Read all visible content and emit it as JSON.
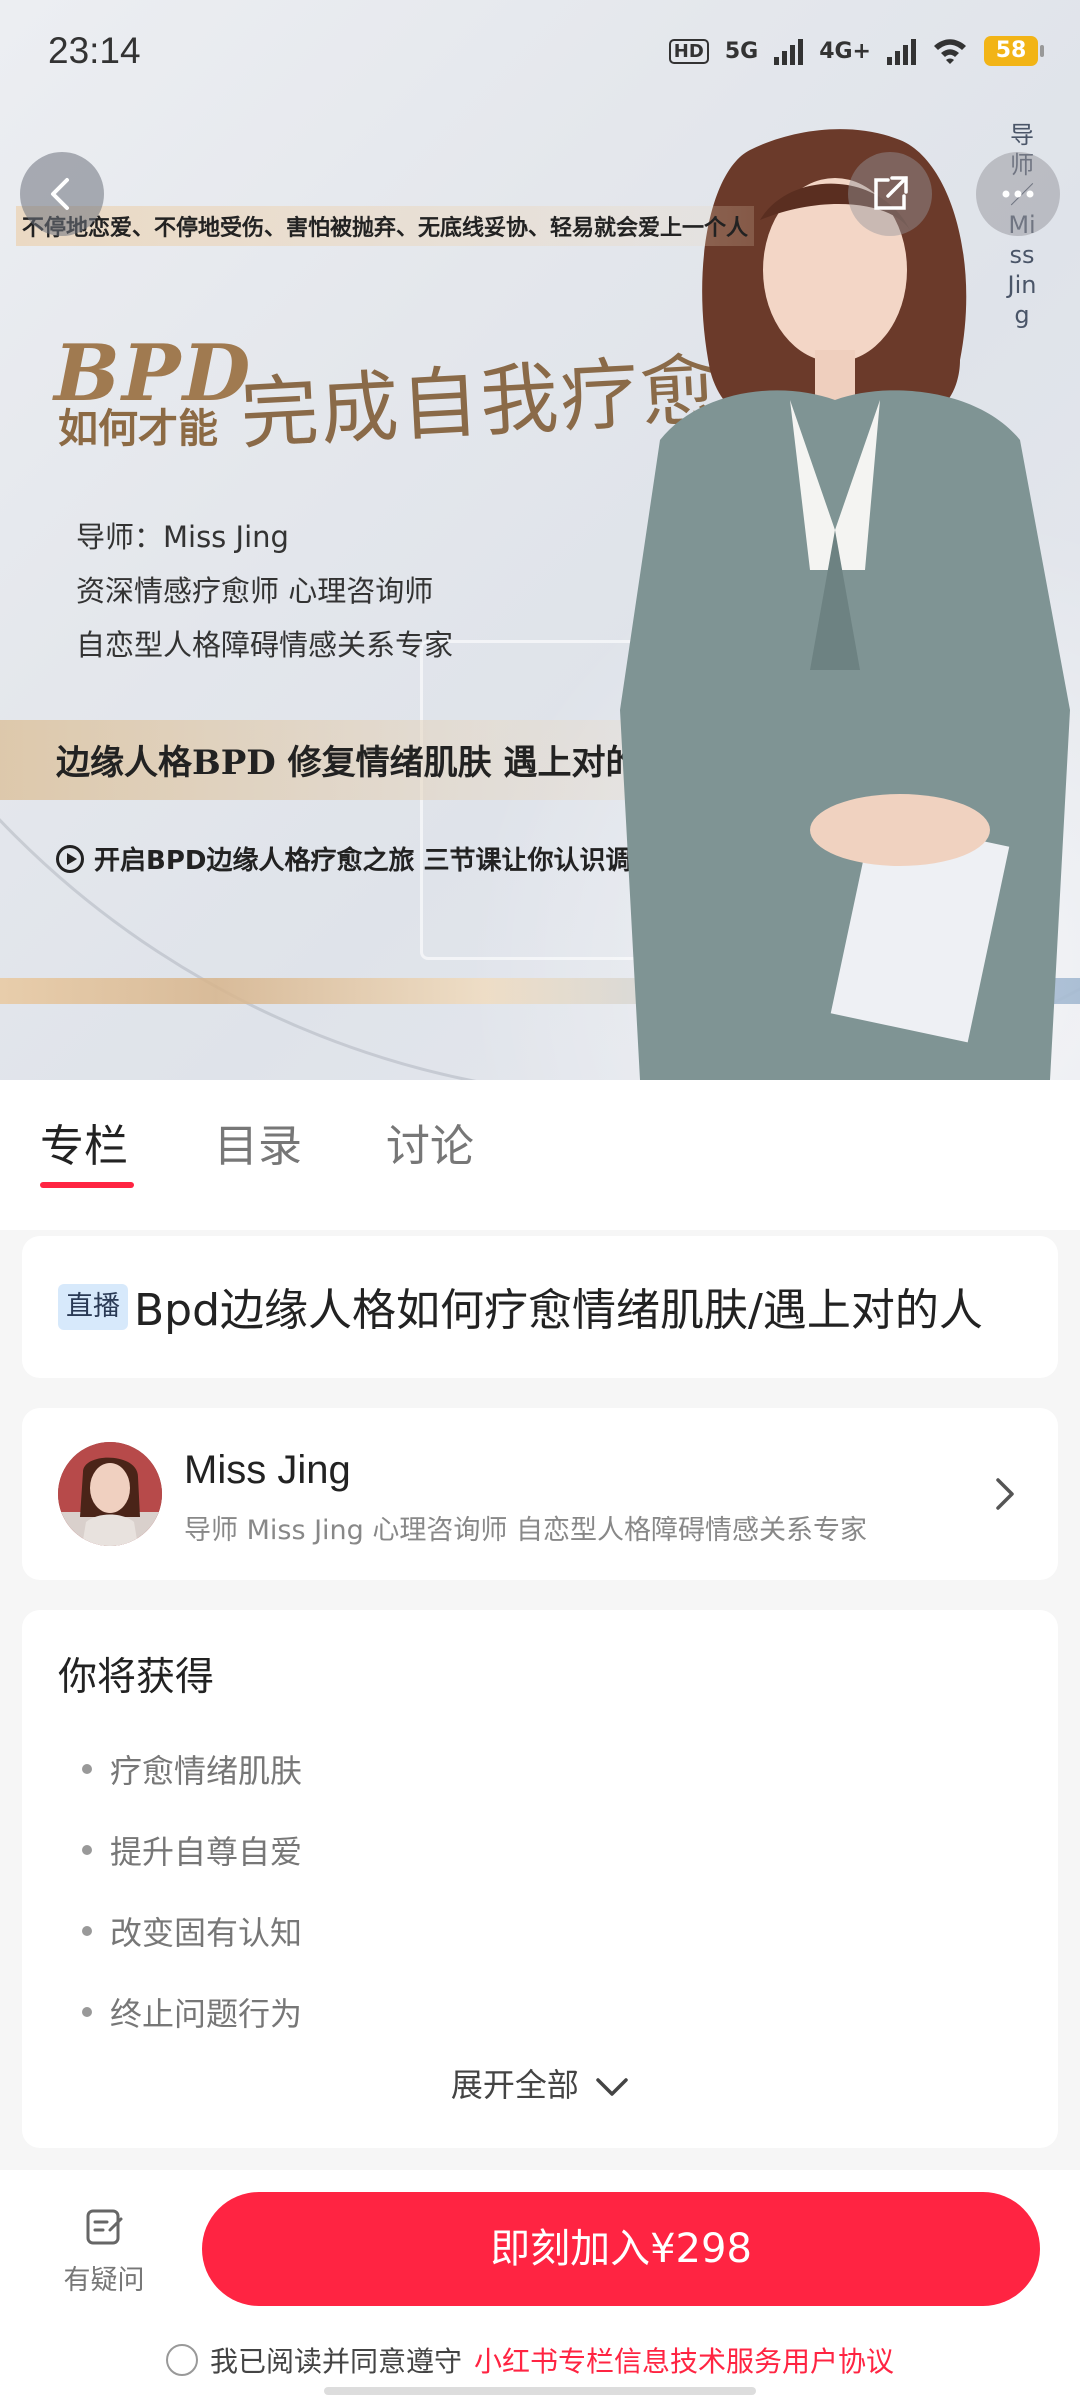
{
  "status_bar": {
    "time": "23:14",
    "hd_label": "HD",
    "net1": "5G",
    "net2": "4G+",
    "battery": "58"
  },
  "hero": {
    "top_strip": "不停地恋爱、不停地受伤、害怕被抛弃、无底线妥协、轻易就会爱上一个人",
    "bpd": "BPD",
    "ruhe": "如何才能",
    "big_title": "完成自我疗愈",
    "info_line1": "导师：Miss Jing",
    "info_line2": "资深情感疗愈师 心理咨询师",
    "info_line3": "自恋型人格障碍情感关系专家",
    "slogan": "边缘人格BPD  修复情绪肌肤  遇上对的人",
    "play_line": "开启BPD边缘人格疗愈之旅 三节课让你认识调整完善自我",
    "vertical_text": "导师／Miss Jing"
  },
  "tabs": [
    {
      "label": "专栏"
    },
    {
      "label": "目录"
    },
    {
      "label": "讨论"
    }
  ],
  "course": {
    "badge": "直播",
    "title": "Bpd边缘人格如何疗愈情绪肌肤/遇上对的人"
  },
  "mentor": {
    "name": "Miss Jing",
    "description": "导师 Miss Jing 心理咨询师 自恋型人格障碍情感关系专家"
  },
  "gains": {
    "heading": "你将获得",
    "items": [
      "疗愈情绪肌肤",
      "提升自尊自爱",
      "改变固有认知",
      "终止问题行为"
    ],
    "expand_label": "展开全部"
  },
  "bottom": {
    "ask_label": "有疑问",
    "join_label": "即刻加入¥298",
    "agree_text": "我已阅读并同意遵守",
    "agree_link": "小红书专栏信息技术服务用户协议"
  },
  "colors": {
    "accent": "#ff2442",
    "badge_bg": "#d7e9fb",
    "battery": "#f2b416"
  }
}
